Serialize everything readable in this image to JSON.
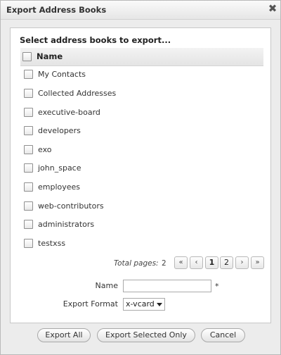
{
  "dialog": {
    "title": "Export Address Books",
    "close_glyph": "✖"
  },
  "list": {
    "heading": "Select address books to export...",
    "column_header": "Name",
    "items": [
      {
        "label": "My Contacts"
      },
      {
        "label": "Collected Addresses"
      },
      {
        "label": "executive-board"
      },
      {
        "label": "developers"
      },
      {
        "label": "exo"
      },
      {
        "label": "john_space"
      },
      {
        "label": "employees"
      },
      {
        "label": "web-contributors"
      },
      {
        "label": "administrators"
      },
      {
        "label": "testxss"
      }
    ]
  },
  "pager": {
    "total_label": "Total pages:",
    "total_pages": "2",
    "first": "«",
    "prev": "‹",
    "pages": [
      "1",
      "2"
    ],
    "current_page": "1",
    "next": "›",
    "last": "»"
  },
  "form": {
    "name_label": "Name",
    "name_value": "",
    "required_marker": "*",
    "format_label": "Export Format",
    "format_value": "x-vcard"
  },
  "buttons": {
    "export_all": "Export All",
    "export_selected": "Export Selected Only",
    "cancel": "Cancel"
  }
}
